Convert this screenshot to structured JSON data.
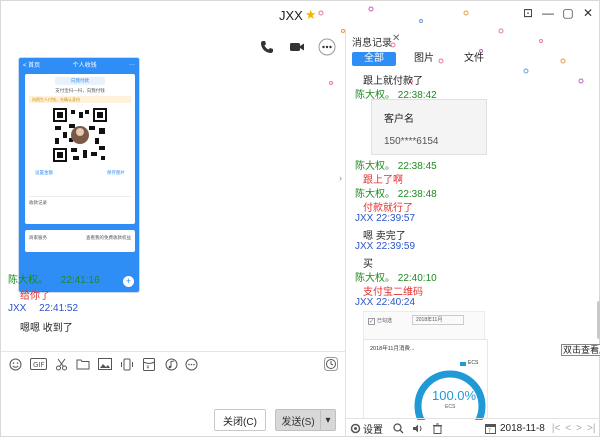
{
  "window": {
    "title": "JXX",
    "minimize": "—",
    "restore": "▢",
    "close": "✕",
    "tray": "⊡"
  },
  "phone": {
    "back": "< 首页",
    "title": "个人收钱",
    "more": "···",
    "tag": "向我付款",
    "subtitle": "支付宝扫一扫，向我付钱",
    "warning": "向陌生人付钱，先确认身份",
    "set_amount": "设置金额",
    "save_image": "保存图片",
    "record": "收款记录",
    "merchant": "商家服务",
    "merchant_sub": "查看我的免费收款权益"
  },
  "chat": [
    {
      "nick": "陈大权。",
      "time": "22:41:16",
      "text": "给你了"
    },
    {
      "nick": "JXX",
      "time": "22:41:52",
      "text": "嗯嗯 收到了"
    }
  ],
  "buttons": {
    "close": "关闭(C)",
    "send": "发送(S)",
    "send_arrow": "▾"
  },
  "history": {
    "title": "消息记录",
    "close": "✕",
    "tabs": [
      "全部",
      "图片",
      "文件"
    ],
    "lines": [
      {
        "type": "text",
        "text": "跟上就付款了",
        "color": "black"
      },
      {
        "type": "head",
        "nick": "陈大权。",
        "time": "22:38:42",
        "color": "green"
      },
      {
        "type": "head",
        "nick": "陈大权。",
        "time": "22:38:45",
        "color": "green"
      },
      {
        "type": "text",
        "text": "跟上了啊",
        "color": "red"
      },
      {
        "type": "head",
        "nick": "陈大权。",
        "time": "22:38:48",
        "color": "green"
      },
      {
        "type": "text",
        "text": "付款就行了",
        "color": "red"
      },
      {
        "type": "head",
        "nick": "JXX",
        "time": "22:39:57",
        "color": "blue"
      },
      {
        "type": "text",
        "text": "嗯  卖完了",
        "color": "black"
      },
      {
        "type": "head",
        "nick": "JXX",
        "time": "22:39:59",
        "color": "blue"
      },
      {
        "type": "text",
        "text": "买",
        "color": "black"
      },
      {
        "type": "head",
        "nick": "陈大权。",
        "time": "22:40:10",
        "color": "green"
      },
      {
        "type": "text",
        "text": "支付宝二维码",
        "color": "red"
      },
      {
        "type": "head",
        "nick": "JXX",
        "time": "22:40:24",
        "color": "blue"
      }
    ],
    "biz_card": {
      "label": "客户名",
      "number": "150****6154"
    },
    "shot": {
      "checkbox_label": "已勾选",
      "month": "2018年11月",
      "chart_title": "2018年11月消费...",
      "legend": "ECS",
      "percent": "100.0%",
      "center_sub": "ECS"
    },
    "tooltip": "双击查看原",
    "bottom": {
      "settings": "设置",
      "date": "2018-11-8",
      "first": "|<",
      "prev": "<",
      "next": ">",
      "last": ">|"
    }
  },
  "colors": {
    "accent": "#2f8ef5",
    "green_nick": "#1e8a1e",
    "blue_nick": "#2a55c8",
    "red_text": "#e03030"
  }
}
